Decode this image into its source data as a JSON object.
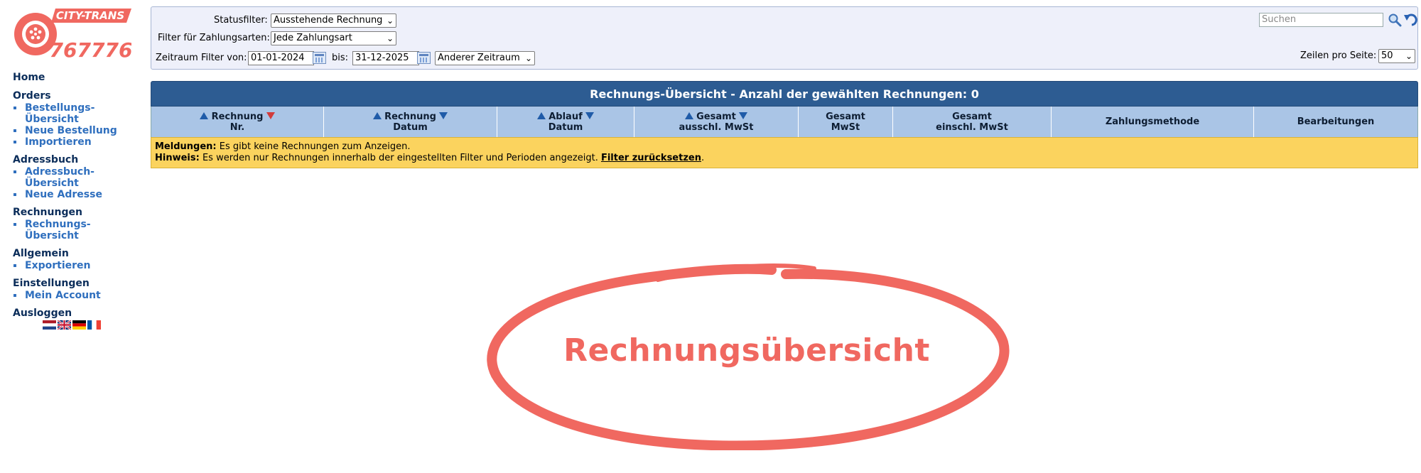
{
  "brand": {
    "logo_text_top": "CITY-TRANS",
    "logo_text_bottom": "767776",
    "primary_color": "#f06860"
  },
  "sidebar": {
    "sections": [
      {
        "heading": "Home",
        "items": []
      },
      {
        "heading": "Orders",
        "items": [
          "Bestellungs-Übersicht",
          "Neue Bestellung",
          "Importieren"
        ]
      },
      {
        "heading": "Adressbuch",
        "items": [
          "Adressbuch-Übersicht",
          "Neue Adresse"
        ]
      },
      {
        "heading": "Rechnungen",
        "items": [
          "Rechnungs-Übersicht"
        ]
      },
      {
        "heading": "Allgemein",
        "items": [
          "Exportieren"
        ]
      },
      {
        "heading": "Einstellungen",
        "items": [
          "Mein Account"
        ]
      },
      {
        "heading": "Ausloggen",
        "items": []
      }
    ],
    "languages": [
      "nl",
      "en",
      "de",
      "fr"
    ]
  },
  "filters": {
    "status_label": "Statusfilter:",
    "status_value": "Ausstehende Rechnung",
    "payment_label": "Filter für Zahlungsarten:",
    "payment_value": "Jede Zahlungsart",
    "period_label": "Zeitraum Filter von:",
    "date_from": "01-01-2024",
    "to_label": "bis:",
    "date_to": "31-12-2025",
    "period_value": "Anderer Zeitraum",
    "search_placeholder": "Suchen",
    "rows_label": "Zeilen pro Seite:",
    "rows_value": "50"
  },
  "table": {
    "title": "Rechnungs-Übersicht - Anzahl der gewählten Rechnungen: 0",
    "columns": [
      {
        "line1": "Rechnung",
        "line2": "Nr.",
        "sortable": true,
        "active_desc": true
      },
      {
        "line1": "Rechnung",
        "line2": "Datum",
        "sortable": true
      },
      {
        "line1": "Ablauf",
        "line2": "Datum",
        "sortable": true
      },
      {
        "line1": "Gesamt",
        "line2": "ausschl. MwSt",
        "sortable": true
      },
      {
        "line1": "Gesamt",
        "line2": "MwSt",
        "sortable": false
      },
      {
        "line1": "Gesamt",
        "line2": "einschl. MwSt",
        "sortable": false
      },
      {
        "line1": "Zahlungsmethode",
        "line2": "",
        "sortable": false
      },
      {
        "line1": "Bearbeitungen",
        "line2": "",
        "sortable": false
      }
    ],
    "messages_label": "Meldungen:",
    "messages_text": "Es gibt keine Rechnungen zum Anzeigen.",
    "hint_label": "Hinweis:",
    "hint_text": "Es werden nur Rechnungen innerhalb der eingestellten Filter und Perioden angezeigt.",
    "reset_link": "Filter zurücksetzen",
    "hint_end": "."
  },
  "annotation": {
    "text": "Rechnungsübersicht",
    "color": "#f06860"
  }
}
